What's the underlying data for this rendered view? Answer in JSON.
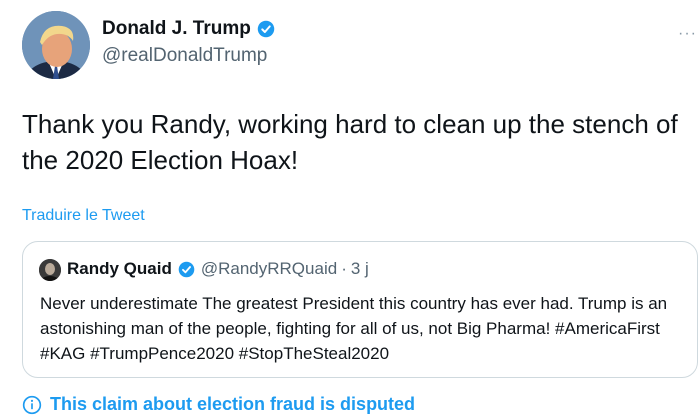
{
  "author": {
    "display_name": "Donald J. Trump",
    "handle": "@realDonaldTrump",
    "verified": true,
    "avatar_icon": "portrait-avatar"
  },
  "more_icon": "ellipsis-icon",
  "tweet": {
    "text": "Thank you Randy, working hard to clean up the stench of the 2020 Election Hoax!",
    "translate_label": "Traduire le Tweet"
  },
  "quoted": {
    "display_name": "Randy Quaid",
    "handle": "@RandyRRQuaid",
    "separator": "·",
    "time": "3 j",
    "verified": true,
    "text": "Never underestimate The greatest President this country has ever had. Trump is an astonishing man of the people, fighting for all of us, not Big Pharma! #AmericaFirst #KAG #TrumpPence2020 #StopTheSteal2020"
  },
  "notice": {
    "text": "This claim about election fraud is disputed"
  },
  "colors": {
    "accent": "#1d9bf0",
    "secondary_text": "#536471",
    "border": "#cfd9de"
  }
}
